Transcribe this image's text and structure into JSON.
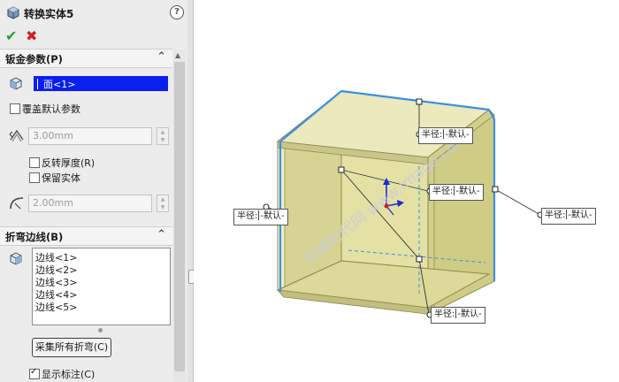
{
  "header": {
    "title": "转换实体5",
    "help_glyph": "?"
  },
  "sections": {
    "sheetmetal": {
      "title": "钣金参数(P)",
      "face_value": "面<1>",
      "override_default": "覆盖默认参数",
      "thickness": "3.00mm",
      "reverse_thickness": "反转厚度(R)",
      "keep_body": "保留实体",
      "radius": "2.00mm"
    },
    "bend_edges": {
      "title": "折弯边线(B)",
      "edges": [
        "边线<1>",
        "边线<2>",
        "边线<3>",
        "边线<4>",
        "边线<5>"
      ],
      "collect_button": "采集所有折弯(C)",
      "show_callouts": "显示标注(C)"
    }
  },
  "viewport": {
    "callouts": [
      {
        "name": "callout-top",
        "label": "半径:",
        "value": "-默认-"
      },
      {
        "name": "callout-middle",
        "label": "半径:",
        "value": "-默认-"
      },
      {
        "name": "callout-left",
        "label": "半径:",
        "value": "-默认-"
      },
      {
        "name": "callout-right",
        "label": "半径:",
        "value": "-默认-"
      },
      {
        "name": "callout-bottom",
        "label": "半径:",
        "value": "-默认-"
      }
    ],
    "watermark": "机械时代网 www.image.com"
  },
  "colors": {
    "accent_blue": "#0a1ef0",
    "ok_green": "#23a02a",
    "cancel_red": "#d0201a",
    "panel_fill": "#e6e3a6",
    "edge_blue": "#3d8fe0"
  }
}
